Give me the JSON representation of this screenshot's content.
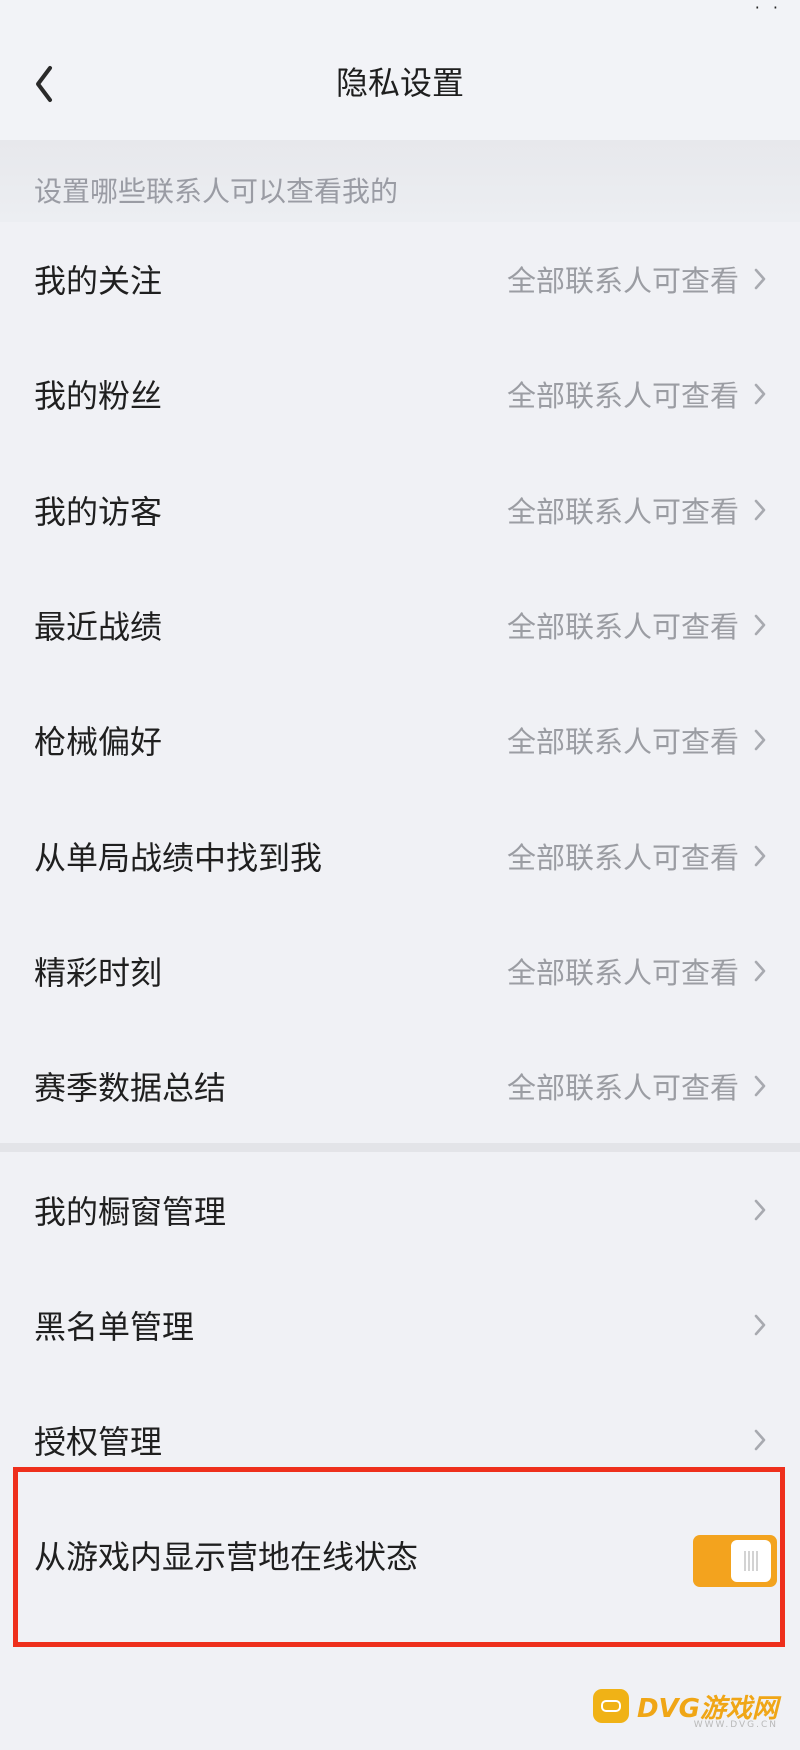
{
  "header": {
    "title": "隐私设置",
    "status_fragment": "· ·"
  },
  "section_header": "设置哪些联系人可以查看我的",
  "visibility_rows": [
    {
      "label": "我的关注",
      "value": "全部联系人可查看"
    },
    {
      "label": "我的粉丝",
      "value": "全部联系人可查看"
    },
    {
      "label": "我的访客",
      "value": "全部联系人可查看"
    },
    {
      "label": "最近战绩",
      "value": "全部联系人可查看"
    },
    {
      "label": "枪械偏好",
      "value": "全部联系人可查看"
    },
    {
      "label": "从单局战绩中找到我",
      "value": "全部联系人可查看"
    },
    {
      "label": "精彩时刻",
      "value": "全部联系人可查看"
    },
    {
      "label": "赛季数据总结",
      "value": "全部联系人可查看"
    }
  ],
  "manage_rows": [
    {
      "label": "我的橱窗管理"
    },
    {
      "label": "黑名单管理"
    },
    {
      "label": "授权管理"
    }
  ],
  "toggle_row": {
    "label": "从游戏内显示营地在线状态",
    "enabled": true
  },
  "watermark": {
    "text": "DVG游戏网",
    "sub": "WWW.DVG.CN"
  },
  "colors": {
    "toggle_on": "#f3a31e",
    "highlight": "#ee2f1c",
    "background": "#f0f1f5"
  }
}
